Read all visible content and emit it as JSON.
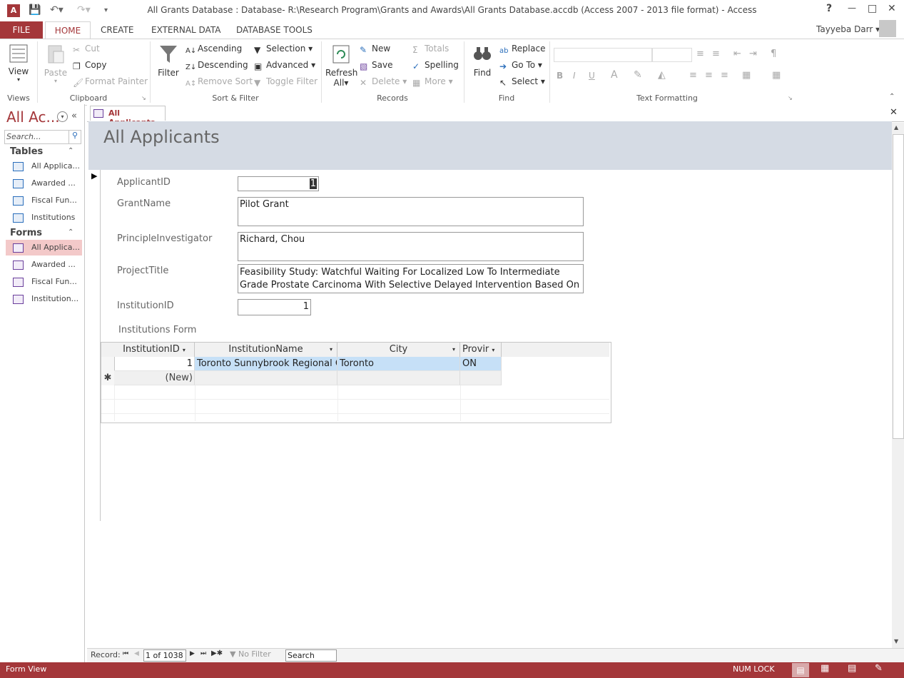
{
  "window": {
    "title": "All Grants Database : Database- R:\\Research Program\\Grants and Awards\\All Grants Database.accdb (Access 2007 - 2013 file format) - Access",
    "help": "?",
    "minimize": "—",
    "maximize": "□",
    "close": "✕",
    "user": "Tayyeba Darr"
  },
  "tabs": {
    "file": "FILE",
    "home": "HOME",
    "create": "CREATE",
    "external": "EXTERNAL DATA",
    "dbtools": "DATABASE TOOLS"
  },
  "ribbon": {
    "views": {
      "view": "View",
      "label": "Views"
    },
    "clipboard": {
      "paste": "Paste",
      "cut": "Cut",
      "copy": "Copy",
      "format_painter": "Format Painter",
      "label": "Clipboard"
    },
    "sort_filter": {
      "filter": "Filter",
      "ascending": "Ascending",
      "descending": "Descending",
      "remove_sort": "Remove Sort",
      "selection": "Selection",
      "advanced": "Advanced",
      "toggle_filter": "Toggle Filter",
      "label": "Sort & Filter"
    },
    "records": {
      "refresh": "Refresh",
      "refresh2": "All",
      "new": "New",
      "save": "Save",
      "delete": "Delete",
      "totals": "Totals",
      "spelling": "Spelling",
      "more": "More",
      "label": "Records"
    },
    "find": {
      "find": "Find",
      "replace": "Replace",
      "goto": "Go To",
      "select": "Select",
      "label": "Find"
    },
    "text_formatting": {
      "label": "Text Formatting"
    }
  },
  "nav": {
    "title": "All Ac...",
    "search_placeholder": "Search...",
    "tables_header": "Tables",
    "tables": [
      "All Applica...",
      "Awarded ...",
      "Fiscal Fun...",
      "Institutions"
    ],
    "forms_header": "Forms",
    "forms": [
      "All Applica...",
      "Awarded ...",
      "Fiscal Fun...",
      "Institution..."
    ]
  },
  "doc_tab": "All Applicants",
  "form": {
    "title": "All Applicants",
    "fields": {
      "applicant_id_label": "ApplicantID",
      "applicant_id": "1",
      "grant_name_label": "GrantName",
      "grant_name": "Pilot Grant",
      "pi_label": "PrincipleInvestigator",
      "pi": "Richard, Chou",
      "project_title_label": "ProjectTitle",
      "project_title_1": "Feasibility Study: Watchful Waiting For Localized Low To Intermediate",
      "project_title_2": "Grade Prostate Carcinoma With Selective Delayed Intervention Based On",
      "institution_id_label": "InstitutionID",
      "institution_id": "1"
    },
    "subform_label": "Institutions Form",
    "subform": {
      "columns": [
        "InstitutionID",
        "InstitutionName",
        "City",
        "Provir"
      ],
      "rows": [
        {
          "id": "1",
          "name": "Toronto Sunnybrook Regional C",
          "city": "Toronto",
          "prov": "ON"
        }
      ],
      "new_row": "(New)"
    }
  },
  "record_nav": {
    "label": "Record:",
    "current": "1 of 1038",
    "no_filter": "No Filter",
    "search": "Search"
  },
  "status": {
    "view": "Form View",
    "numlock": "NUM LOCK"
  },
  "colors": {
    "accent": "#a4373a",
    "form_header": "#d5dbe4",
    "selection": "#c6e0f7",
    "nav_selected": "#f3c9c9"
  }
}
